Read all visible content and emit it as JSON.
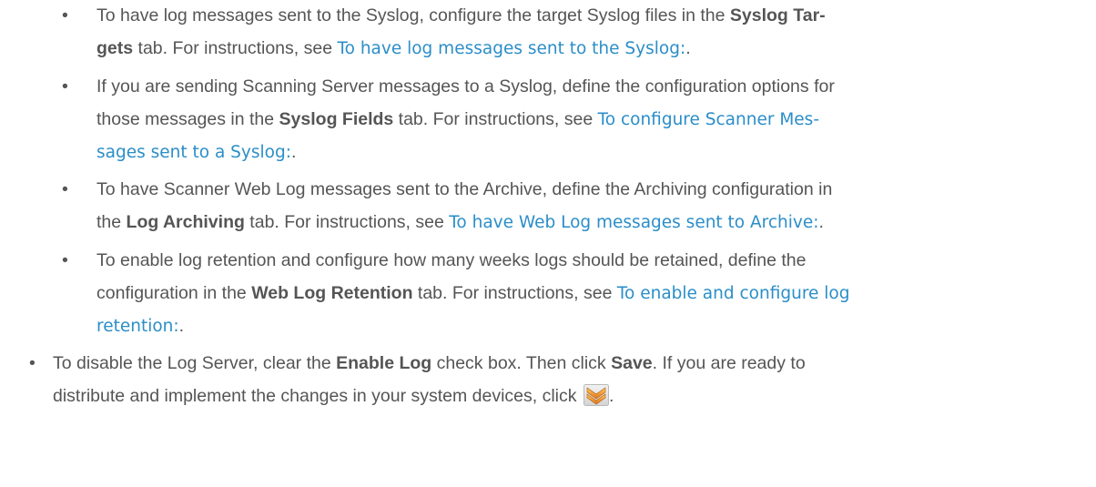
{
  "bullet_char": "•",
  "items": [
    {
      "lines": [
        [
          "To have log messages sent to the Syslog, configure the target Syslog files in the ",
          {
            "b": "Syslog Tar-"
          }
        ],
        [
          {
            "b": "gets"
          },
          " tab. For instructions, see ",
          {
            "a": "To have log messages sent to the Syslog:"
          },
          "."
        ]
      ]
    },
    {
      "lines": [
        [
          "If you are sending Scanning Server messages to a Syslog, define the configuration options for"
        ],
        [
          "those messages in the ",
          {
            "b": "Syslog Fields"
          },
          " tab. For instructions, see ",
          {
            "a": "To configure Scanner Mes-"
          }
        ],
        [
          {
            "a": "sages sent to a Syslog:"
          },
          "."
        ]
      ]
    },
    {
      "lines": [
        [
          "To have Scanner Web Log messages sent to the Archive, define the Archiving configuration in"
        ],
        [
          "the ",
          {
            "b": "Log Archiving"
          },
          " tab. For instructions, see ",
          {
            "a": "To have Web Log messages sent to Archive:"
          },
          "."
        ]
      ]
    },
    {
      "lines": [
        [
          "To enable log retention and configure how many weeks logs should be retained, define the"
        ],
        [
          "configuration in the ",
          {
            "b": "Web Log Retention"
          },
          " tab. For instructions, see ",
          {
            "a": "To enable and configure log"
          }
        ],
        [
          {
            "a": "retention:"
          },
          "."
        ]
      ]
    },
    {
      "lines": [
        [
          "To disable the Log Server, clear the ",
          {
            "b": "Enable Log"
          },
          " check box. Then click ",
          {
            "b": "Save"
          },
          ". If you are ready to"
        ],
        [
          "distribute and implement the changes in your system devices, click ",
          {
            "icon": "distribute-icon"
          },
          "."
        ]
      ]
    }
  ]
}
